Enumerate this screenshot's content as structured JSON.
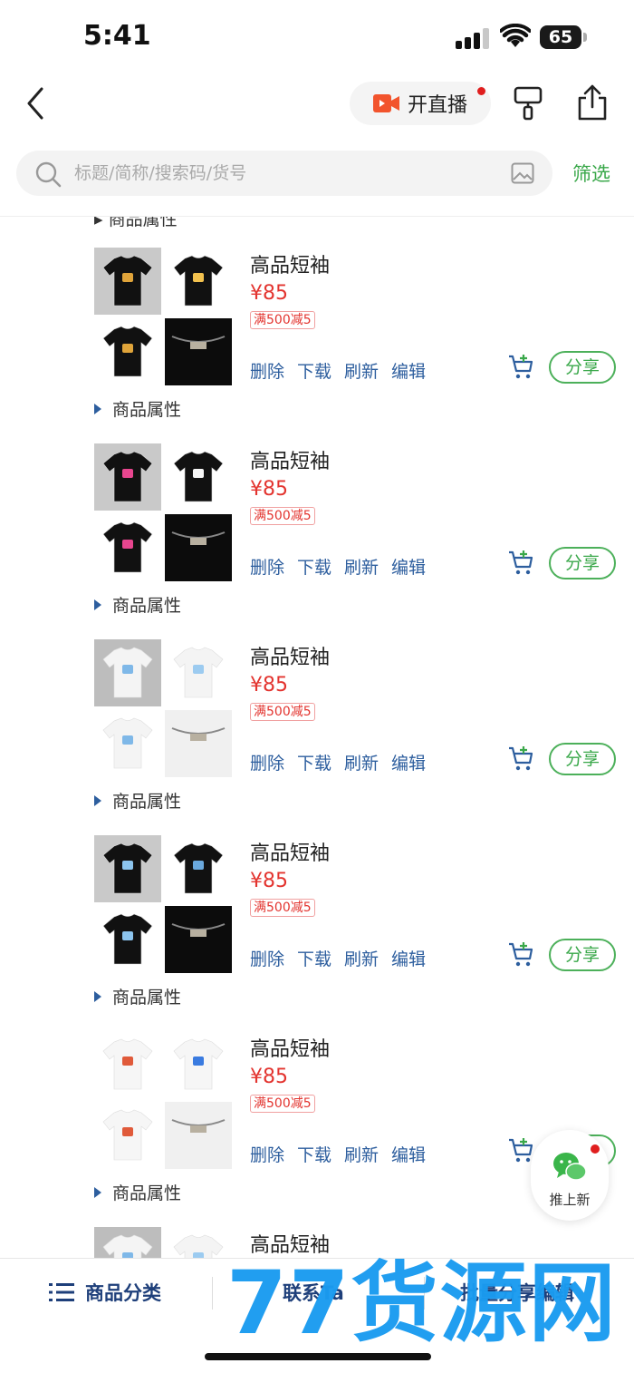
{
  "status": {
    "time": "5:41",
    "battery": "65"
  },
  "nav": {
    "live_label": "开直播"
  },
  "search": {
    "placeholder": "标题/简称/搜索码/货号",
    "filter_label": "筛选"
  },
  "list": {
    "partial_attr": "▸ 商品属性",
    "items": [
      {
        "title": "高品短袖",
        "price": "¥85",
        "promo": "满500减5",
        "actions": [
          "删除",
          "下载",
          "刷新",
          "编辑"
        ],
        "share": "分享",
        "attr": "商品属性",
        "style": "black-gold"
      },
      {
        "title": "高品短袖",
        "price": "¥85",
        "promo": "满500减5",
        "actions": [
          "删除",
          "下载",
          "刷新",
          "编辑"
        ],
        "share": "分享",
        "attr": "商品属性",
        "style": "black-pink"
      },
      {
        "title": "高品短袖",
        "price": "¥85",
        "promo": "满500减5",
        "actions": [
          "删除",
          "下载",
          "刷新",
          "编辑"
        ],
        "share": "分享",
        "attr": "商品属性",
        "style": "white-blue"
      },
      {
        "title": "高品短袖",
        "price": "¥85",
        "promo": "满500减5",
        "actions": [
          "删除",
          "下载",
          "刷新",
          "编辑"
        ],
        "share": "分享",
        "attr": "商品属性",
        "style": "black-blue"
      },
      {
        "title": "高品短袖",
        "price": "¥85",
        "promo": "满500减5",
        "actions": [
          "删除",
          "下载",
          "刷新",
          "编辑"
        ],
        "share": "分享",
        "attr": "商品属性",
        "style": "white-colorful"
      },
      {
        "title": "高品短袖",
        "price": "",
        "promo": "",
        "actions": [],
        "share": "",
        "attr": "",
        "style": "white-blue"
      }
    ]
  },
  "float_button": {
    "label": "推上新"
  },
  "bottom_bar": {
    "category_label": "商品分类",
    "contact_label": "联系Ta",
    "batch_label": "批量分享编辑"
  },
  "watermark": "77货源网",
  "colors": {
    "accent_green": "#3aa84a",
    "price_red": "#e3342f",
    "link_blue": "#2d5e9e",
    "watermark_blue": "#1a9bf0"
  }
}
